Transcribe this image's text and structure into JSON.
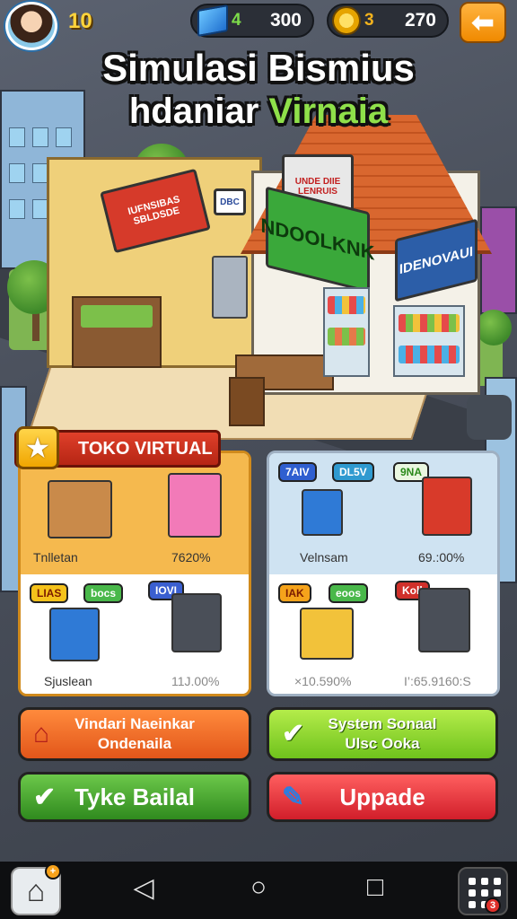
{
  "hud": {
    "level": "10",
    "gems": {
      "icon": "gem-icon",
      "count": "4",
      "value": "300"
    },
    "coins": {
      "icon": "coin-icon",
      "count": "3",
      "value": "270"
    },
    "back_icon": "arrow-left-icon"
  },
  "title": {
    "line1": "Simulasi Bismius",
    "line2_white": "hdaniar ",
    "line2_green": "Virnaia"
  },
  "scene_signs": {
    "left_sign": "IUFNSIBAS SBLDSDE",
    "left_small": "DBC",
    "green_sign": "NDOOLKNK",
    "red_sign": "UNDE DIIE LENRUIS",
    "blue_sign": "IDENOVAUI"
  },
  "left_panel": {
    "ribbon": "TOKO VIRTUAL",
    "top_label": "Tnlletan",
    "top_value": "7620%",
    "chips": [
      "LIAS",
      "bocs",
      "IOVI"
    ],
    "bottom_label": "Sjuslean",
    "bottom_value": "11J.00%"
  },
  "right_panel": {
    "chips_top": [
      "7AIV",
      "DL5V",
      "9NA"
    ],
    "top_label": "Velnsam",
    "top_value": "69.:00%",
    "chips_bottom": [
      "IAK",
      "eoos",
      "Koll"
    ],
    "bottom_left_value": "×10.590%",
    "bottom_right_value": "I’:65.9160:S"
  },
  "buttons": {
    "orange": {
      "line1": "Vindari Naeinkar",
      "line2": "Ondenaila"
    },
    "lime": {
      "line1": "System Sonaal",
      "line2": "Ulsc Ooka"
    },
    "green": "Tyke Bailal",
    "red": "Uppade"
  },
  "colors": {
    "accent_orange": "#f08a00",
    "ribbon_red": "#c8301c",
    "lime": "#8fd630",
    "green": "#3c9a26",
    "red": "#e0303a"
  }
}
